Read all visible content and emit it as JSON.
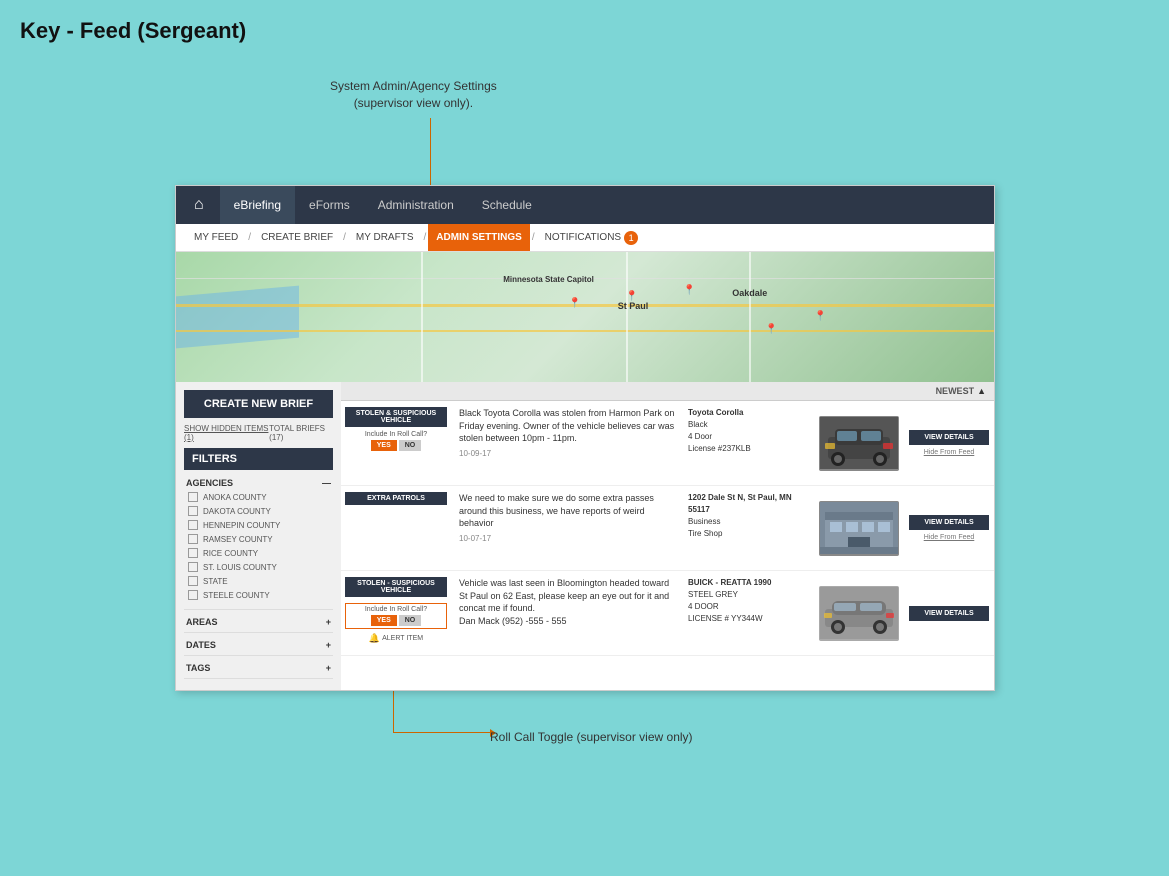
{
  "page": {
    "title": "Key - Feed (Sergeant)",
    "annotation_admin": "System Admin/Agency Settings\n(supervisor view only).",
    "annotation_rollcall": "Roll Call Toggle (supervisor view only)"
  },
  "nav": {
    "home_icon": "🏠",
    "items": [
      {
        "label": "eBriefing",
        "active": true
      },
      {
        "label": "eForms",
        "active": false
      },
      {
        "label": "Administration",
        "active": false
      },
      {
        "label": "Schedule",
        "active": false
      }
    ]
  },
  "sub_nav": {
    "items": [
      {
        "label": "MY FEED",
        "active": false
      },
      {
        "label": "CREATE BRIEF",
        "active": false
      },
      {
        "label": "MY DRAFTS",
        "active": false
      },
      {
        "label": "ADMIN SETTINGS",
        "active": true
      },
      {
        "label": "NOTIFICATIONS",
        "active": false,
        "badge": "1"
      }
    ]
  },
  "sidebar": {
    "create_brief_label": "CREATE NEW BRIEF",
    "show_hidden_label": "SHOW HIDDEN ITEMS (1)",
    "total_briefs_label": "TOTAL BRIEFS (17)",
    "filters_label": "FILTERS",
    "agencies_label": "AGENCIES",
    "agencies": [
      "ANOKA COUNTY",
      "DAKOTA COUNTY",
      "HENNEPIN COUNTY",
      "RAMSEY COUNTY",
      "RICE COUNTY",
      "ST. LOUIS COUNTY",
      "STATE",
      "STEELE COUNTY"
    ],
    "areas_label": "AREAS",
    "dates_label": "DATES",
    "tags_label": "TAGS"
  },
  "feed": {
    "sort_label": "NEWEST",
    "sort_arrow": "▲",
    "items": [
      {
        "type": "STOLEN & SUSPICIOUS VEHICLE",
        "roll_call_label": "Include In Roll Call?",
        "roll_call_yes": "YES",
        "roll_call_no": "NO",
        "description": "Black Toyota Corolla was stolen from Harmon Park on Friday evening. Owner of the vehicle believes car was stolen between 10pm - 11pm.",
        "car_make": "Toyota Corolla",
        "car_color": "Black",
        "car_doors": "4 Door",
        "car_license": "License #237KLB",
        "date": "10-09-17",
        "btn_view": "VIEW DETAILS",
        "btn_hide": "Hide From Feed",
        "img_alt": "black sedan car"
      },
      {
        "type": "EXTRA PATROLS",
        "roll_call_label": "",
        "roll_call_yes": "",
        "roll_call_no": "",
        "description": "We need to make sure we do some extra passes around this business, we have reports of weird behavior",
        "car_make": "1202 Dale St N, St Paul, MN 55117",
        "car_color": "Business",
        "car_doors": "Tire Shop",
        "car_license": "",
        "date": "10-07-17",
        "btn_view": "VIEW DETAILS",
        "btn_hide": "Hide From Feed",
        "img_alt": "tire shop building"
      },
      {
        "type": "STOLEN - SUSPICIOUS VEHICLE",
        "roll_call_label": "Include In Roll Call?",
        "roll_call_yes": "YES",
        "roll_call_no": "NO",
        "roll_call_outlined": true,
        "alert_label": "ALERT ITEM",
        "description": "Vehicle was last seen in Bloomington headed toward St Paul on 62 East, please keep an eye out for it and concat me if found.\nDan Mack (952) -555 - 555",
        "car_make": "BUICK - REATTA 1990",
        "car_color": "STEEL GREY",
        "car_doors": "4 DOOR",
        "car_license": "LICENSE # YY344W",
        "date": "",
        "btn_view": "VIEW DETAILS",
        "btn_hide": "",
        "img_alt": "grey convertible car"
      }
    ]
  }
}
